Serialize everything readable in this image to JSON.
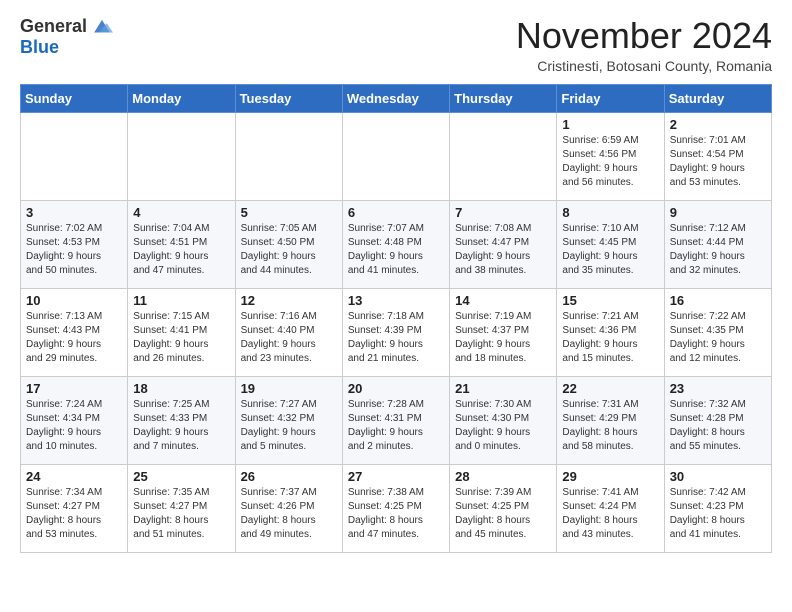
{
  "logo": {
    "general": "General",
    "blue": "Blue"
  },
  "title": "November 2024",
  "subtitle": "Cristinesti, Botosani County, Romania",
  "weekdays": [
    "Sunday",
    "Monday",
    "Tuesday",
    "Wednesday",
    "Thursday",
    "Friday",
    "Saturday"
  ],
  "weeks": [
    [
      {
        "day": "",
        "info": ""
      },
      {
        "day": "",
        "info": ""
      },
      {
        "day": "",
        "info": ""
      },
      {
        "day": "",
        "info": ""
      },
      {
        "day": "",
        "info": ""
      },
      {
        "day": "1",
        "info": "Sunrise: 6:59 AM\nSunset: 4:56 PM\nDaylight: 9 hours\nand 56 minutes."
      },
      {
        "day": "2",
        "info": "Sunrise: 7:01 AM\nSunset: 4:54 PM\nDaylight: 9 hours\nand 53 minutes."
      }
    ],
    [
      {
        "day": "3",
        "info": "Sunrise: 7:02 AM\nSunset: 4:53 PM\nDaylight: 9 hours\nand 50 minutes."
      },
      {
        "day": "4",
        "info": "Sunrise: 7:04 AM\nSunset: 4:51 PM\nDaylight: 9 hours\nand 47 minutes."
      },
      {
        "day": "5",
        "info": "Sunrise: 7:05 AM\nSunset: 4:50 PM\nDaylight: 9 hours\nand 44 minutes."
      },
      {
        "day": "6",
        "info": "Sunrise: 7:07 AM\nSunset: 4:48 PM\nDaylight: 9 hours\nand 41 minutes."
      },
      {
        "day": "7",
        "info": "Sunrise: 7:08 AM\nSunset: 4:47 PM\nDaylight: 9 hours\nand 38 minutes."
      },
      {
        "day": "8",
        "info": "Sunrise: 7:10 AM\nSunset: 4:45 PM\nDaylight: 9 hours\nand 35 minutes."
      },
      {
        "day": "9",
        "info": "Sunrise: 7:12 AM\nSunset: 4:44 PM\nDaylight: 9 hours\nand 32 minutes."
      }
    ],
    [
      {
        "day": "10",
        "info": "Sunrise: 7:13 AM\nSunset: 4:43 PM\nDaylight: 9 hours\nand 29 minutes."
      },
      {
        "day": "11",
        "info": "Sunrise: 7:15 AM\nSunset: 4:41 PM\nDaylight: 9 hours\nand 26 minutes."
      },
      {
        "day": "12",
        "info": "Sunrise: 7:16 AM\nSunset: 4:40 PM\nDaylight: 9 hours\nand 23 minutes."
      },
      {
        "day": "13",
        "info": "Sunrise: 7:18 AM\nSunset: 4:39 PM\nDaylight: 9 hours\nand 21 minutes."
      },
      {
        "day": "14",
        "info": "Sunrise: 7:19 AM\nSunset: 4:37 PM\nDaylight: 9 hours\nand 18 minutes."
      },
      {
        "day": "15",
        "info": "Sunrise: 7:21 AM\nSunset: 4:36 PM\nDaylight: 9 hours\nand 15 minutes."
      },
      {
        "day": "16",
        "info": "Sunrise: 7:22 AM\nSunset: 4:35 PM\nDaylight: 9 hours\nand 12 minutes."
      }
    ],
    [
      {
        "day": "17",
        "info": "Sunrise: 7:24 AM\nSunset: 4:34 PM\nDaylight: 9 hours\nand 10 minutes."
      },
      {
        "day": "18",
        "info": "Sunrise: 7:25 AM\nSunset: 4:33 PM\nDaylight: 9 hours\nand 7 minutes."
      },
      {
        "day": "19",
        "info": "Sunrise: 7:27 AM\nSunset: 4:32 PM\nDaylight: 9 hours\nand 5 minutes."
      },
      {
        "day": "20",
        "info": "Sunrise: 7:28 AM\nSunset: 4:31 PM\nDaylight: 9 hours\nand 2 minutes."
      },
      {
        "day": "21",
        "info": "Sunrise: 7:30 AM\nSunset: 4:30 PM\nDaylight: 9 hours\nand 0 minutes."
      },
      {
        "day": "22",
        "info": "Sunrise: 7:31 AM\nSunset: 4:29 PM\nDaylight: 8 hours\nand 58 minutes."
      },
      {
        "day": "23",
        "info": "Sunrise: 7:32 AM\nSunset: 4:28 PM\nDaylight: 8 hours\nand 55 minutes."
      }
    ],
    [
      {
        "day": "24",
        "info": "Sunrise: 7:34 AM\nSunset: 4:27 PM\nDaylight: 8 hours\nand 53 minutes."
      },
      {
        "day": "25",
        "info": "Sunrise: 7:35 AM\nSunset: 4:27 PM\nDaylight: 8 hours\nand 51 minutes."
      },
      {
        "day": "26",
        "info": "Sunrise: 7:37 AM\nSunset: 4:26 PM\nDaylight: 8 hours\nand 49 minutes."
      },
      {
        "day": "27",
        "info": "Sunrise: 7:38 AM\nSunset: 4:25 PM\nDaylight: 8 hours\nand 47 minutes."
      },
      {
        "day": "28",
        "info": "Sunrise: 7:39 AM\nSunset: 4:25 PM\nDaylight: 8 hours\nand 45 minutes."
      },
      {
        "day": "29",
        "info": "Sunrise: 7:41 AM\nSunset: 4:24 PM\nDaylight: 8 hours\nand 43 minutes."
      },
      {
        "day": "30",
        "info": "Sunrise: 7:42 AM\nSunset: 4:23 PM\nDaylight: 8 hours\nand 41 minutes."
      }
    ]
  ]
}
